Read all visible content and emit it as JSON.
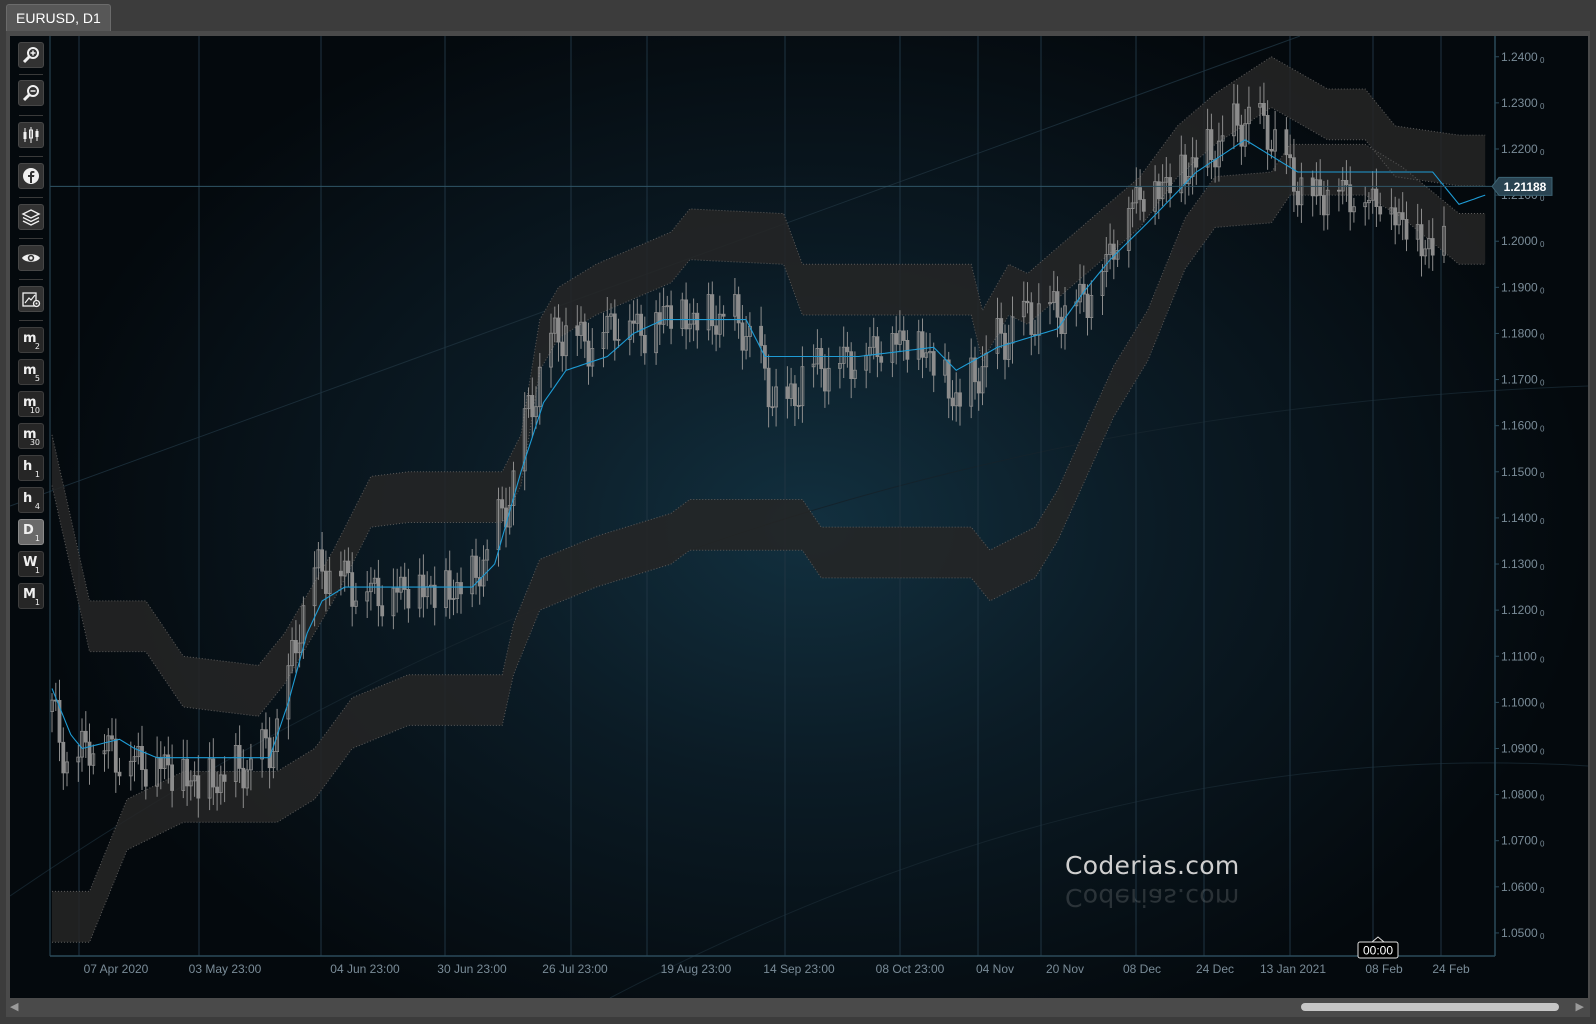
{
  "window": {
    "tab_title": "EURUSD, D1"
  },
  "toolbar": {
    "buttons": [
      {
        "name": "zoom-in-icon"
      },
      {
        "name": "zoom-out-icon"
      },
      {
        "name": "candlestick-icon"
      },
      {
        "name": "facebook-icon"
      },
      {
        "name": "layers-icon"
      },
      {
        "name": "eye-icon"
      },
      {
        "name": "chart-settings-icon"
      }
    ],
    "timeframes": [
      {
        "letter": "m",
        "sub": "2"
      },
      {
        "letter": "m",
        "sub": "5"
      },
      {
        "letter": "m",
        "sub": "10"
      },
      {
        "letter": "m",
        "sub": "30"
      },
      {
        "letter": "h",
        "sub": "1"
      },
      {
        "letter": "h",
        "sub": "4"
      },
      {
        "letter": "D",
        "sub": "1",
        "active": true
      },
      {
        "letter": "W",
        "sub": "1"
      },
      {
        "letter": "M",
        "sub": "1"
      }
    ]
  },
  "chart": {
    "watermark": "Coderias.com",
    "current_price_label": "1.21188",
    "countdown_label": "00:00",
    "colors": {
      "midline": "#1e9bd4",
      "band_fill": "#262626",
      "candle": "#8c8c8c",
      "grid": "#1f3442",
      "axis_text": "#7a8c98",
      "price_tag_bg": "#2a4452"
    }
  },
  "chart_data": {
    "type": "candlestick",
    "symbol": "EURUSD",
    "timeframe": "D1",
    "y_axis": {
      "ticks": [
        "1.2400",
        "1.2300",
        "1.2200",
        "1.2100",
        "1.2000",
        "1.1900",
        "1.1800",
        "1.1700",
        "1.1600",
        "1.1500",
        "1.1400",
        "1.1300",
        "1.1200",
        "1.1100",
        "1.1000",
        "1.0900",
        "1.0800",
        "1.0700",
        "1.0600",
        "1.0500"
      ],
      "tick_suffix": "0",
      "ylim": [
        1.045,
        1.2445
      ]
    },
    "x_axis": {
      "ticks": [
        "07 Apr 2020",
        "03 May 23:00",
        "04 Jun 23:00",
        "30 Jun 23:00",
        "26 Jul 23:00",
        "19 Aug 23:00",
        "14 Sep 23:00",
        "08 Oct 23:00",
        "04 Nov",
        "20 Nov",
        "08 Dec",
        "24 Dec",
        "13 Jan 2021",
        "08 Feb",
        "24 Feb"
      ]
    },
    "current_price": 1.21188,
    "midline": [
      [
        0,
        1.103
      ],
      [
        5,
        1.093
      ],
      [
        8,
        1.09
      ],
      [
        18,
        1.092
      ],
      [
        22,
        1.09
      ],
      [
        28,
        1.088
      ],
      [
        58,
        1.088
      ],
      [
        63,
        1.1
      ],
      [
        68,
        1.115
      ],
      [
        72,
        1.122
      ],
      [
        78,
        1.125
      ],
      [
        84,
        1.125
      ],
      [
        112,
        1.125
      ],
      [
        118,
        1.13
      ],
      [
        125,
        1.15
      ],
      [
        131,
        1.165
      ],
      [
        137,
        1.172
      ],
      [
        148,
        1.175
      ],
      [
        155,
        1.18
      ],
      [
        163,
        1.183
      ],
      [
        185,
        1.183
      ],
      [
        190,
        1.175
      ],
      [
        215,
        1.175
      ],
      [
        235,
        1.177
      ],
      [
        241,
        1.172
      ],
      [
        252,
        1.177
      ],
      [
        268,
        1.181
      ],
      [
        275,
        1.189
      ],
      [
        282,
        1.196
      ],
      [
        292,
        1.204
      ],
      [
        305,
        1.215
      ],
      [
        318,
        1.222
      ],
      [
        332,
        1.215
      ],
      [
        368,
        1.215
      ],
      [
        375,
        1.208
      ],
      [
        382,
        1.21
      ]
    ],
    "upper_band": [
      [
        0,
        1.158
      ],
      [
        10,
        1.122
      ],
      [
        25,
        1.122
      ],
      [
        35,
        1.11
      ],
      [
        55,
        1.108
      ],
      [
        62,
        1.115
      ],
      [
        75,
        1.133
      ],
      [
        85,
        1.149
      ],
      [
        95,
        1.15
      ],
      [
        120,
        1.15
      ],
      [
        125,
        1.158
      ],
      [
        130,
        1.183
      ],
      [
        135,
        1.19
      ],
      [
        145,
        1.195
      ],
      [
        165,
        1.202
      ],
      [
        170,
        1.207
      ],
      [
        195,
        1.206
      ],
      [
        200,
        1.195
      ],
      [
        245,
        1.195
      ],
      [
        248,
        1.185
      ],
      [
        255,
        1.195
      ],
      [
        260,
        1.193
      ],
      [
        290,
        1.214
      ],
      [
        300,
        1.225
      ],
      [
        310,
        1.232
      ],
      [
        325,
        1.24
      ],
      [
        340,
        1.233
      ],
      [
        350,
        1.233
      ],
      [
        358,
        1.225
      ],
      [
        375,
        1.223
      ],
      [
        382,
        1.223
      ]
    ],
    "lower_band": [
      [
        0,
        1.048
      ],
      [
        10,
        1.048
      ],
      [
        20,
        1.068
      ],
      [
        35,
        1.074
      ],
      [
        60,
        1.074
      ],
      [
        70,
        1.079
      ],
      [
        80,
        1.09
      ],
      [
        95,
        1.095
      ],
      [
        120,
        1.095
      ],
      [
        123,
        1.106
      ],
      [
        130,
        1.12
      ],
      [
        145,
        1.125
      ],
      [
        165,
        1.13
      ],
      [
        170,
        1.133
      ],
      [
        200,
        1.133
      ],
      [
        205,
        1.127
      ],
      [
        245,
        1.127
      ],
      [
        250,
        1.122
      ],
      [
        262,
        1.127
      ],
      [
        268,
        1.135
      ],
      [
        283,
        1.162
      ],
      [
        292,
        1.174
      ],
      [
        302,
        1.194
      ],
      [
        310,
        1.203
      ],
      [
        325,
        1.204
      ],
      [
        330,
        1.21
      ],
      [
        350,
        1.21
      ],
      [
        360,
        1.205
      ],
      [
        375,
        1.195
      ],
      [
        382,
        1.195
      ]
    ],
    "close_path": [
      [
        0,
        1.098
      ],
      [
        5,
        1.085
      ],
      [
        10,
        1.092
      ],
      [
        20,
        1.088
      ],
      [
        30,
        1.087
      ],
      [
        40,
        1.082
      ],
      [
        50,
        1.085
      ],
      [
        58,
        1.09
      ],
      [
        62,
        1.1
      ],
      [
        66,
        1.118
      ],
      [
        70,
        1.128
      ],
      [
        74,
        1.13
      ],
      [
        80,
        1.126
      ],
      [
        88,
        1.124
      ],
      [
        96,
        1.126
      ],
      [
        104,
        1.124
      ],
      [
        112,
        1.126
      ],
      [
        118,
        1.136
      ],
      [
        122,
        1.145
      ],
      [
        127,
        1.163
      ],
      [
        132,
        1.177
      ],
      [
        137,
        1.182
      ],
      [
        142,
        1.178
      ],
      [
        148,
        1.182
      ],
      [
        153,
        1.184
      ],
      [
        158,
        1.181
      ],
      [
        164,
        1.186
      ],
      [
        168,
        1.184
      ],
      [
        173,
        1.183
      ],
      [
        180,
        1.184
      ],
      [
        186,
        1.18
      ],
      [
        190,
        1.17
      ],
      [
        196,
        1.163
      ],
      [
        200,
        1.172
      ],
      [
        208,
        1.174
      ],
      [
        216,
        1.176
      ],
      [
        224,
        1.18
      ],
      [
        232,
        1.178
      ],
      [
        238,
        1.17
      ],
      [
        242,
        1.165
      ],
      [
        247,
        1.172
      ],
      [
        252,
        1.178
      ],
      [
        258,
        1.183
      ],
      [
        264,
        1.185
      ],
      [
        270,
        1.186
      ],
      [
        276,
        1.189
      ],
      [
        282,
        1.198
      ],
      [
        288,
        1.21
      ],
      [
        294,
        1.212
      ],
      [
        300,
        1.215
      ],
      [
        306,
        1.218
      ],
      [
        312,
        1.222
      ],
      [
        318,
        1.227
      ],
      [
        324,
        1.225
      ],
      [
        330,
        1.215
      ],
      [
        336,
        1.21
      ],
      [
        342,
        1.213
      ],
      [
        348,
        1.21
      ],
      [
        354,
        1.21
      ],
      [
        360,
        1.205
      ],
      [
        366,
        1.2
      ],
      [
        370,
        1.198
      ],
      [
        374,
        1.203
      ],
      [
        378,
        1.21
      ],
      [
        382,
        1.212
      ]
    ]
  }
}
